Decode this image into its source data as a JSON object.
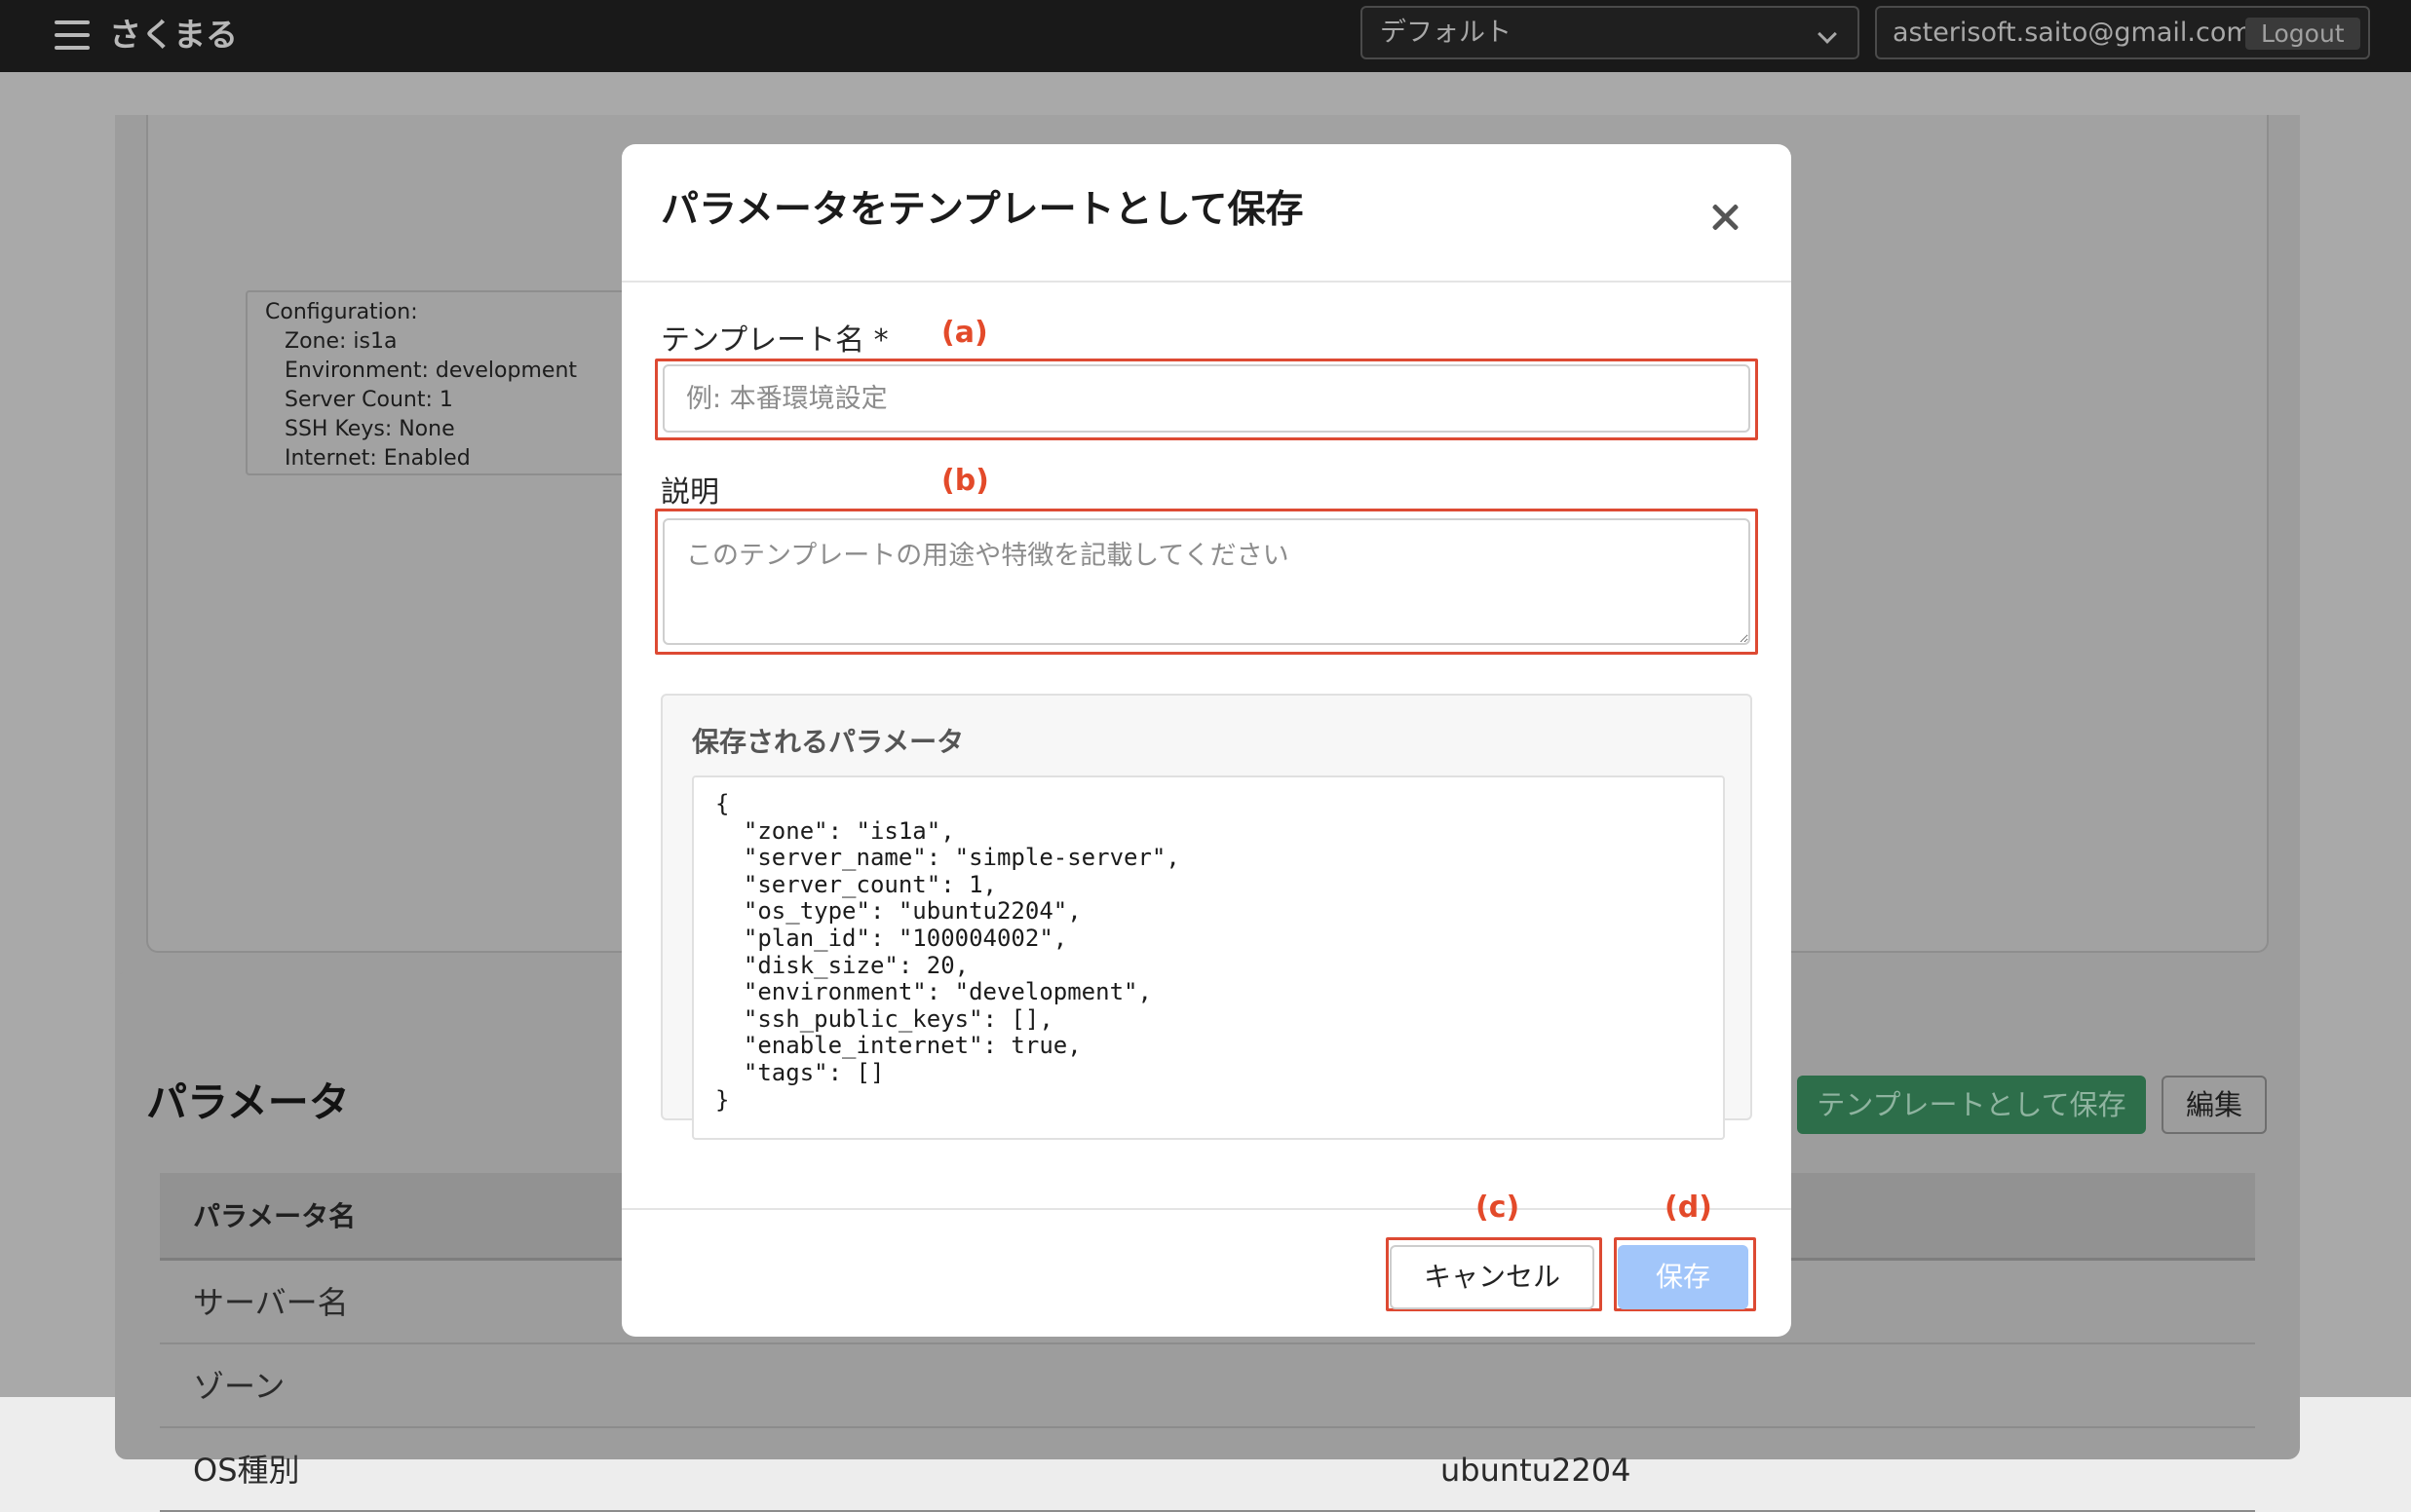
{
  "navbar": {
    "brand": "さくまる",
    "menu_icon": "hamburger-icon",
    "project_selected": "デフォルト",
    "user_email": "asterisoft.saito@gmail.com",
    "logout_label": "Logout"
  },
  "background": {
    "configuration": {
      "title": "Configuration:",
      "lines": [
        "Zone: is1a",
        "Environment: development",
        "Server Count: 1",
        "SSH Keys: None",
        "Internet: Enabled"
      ]
    },
    "parameters": {
      "title": "パラメータ",
      "save_template_label": "テンプレートとして保存",
      "edit_label": "編集",
      "table_header": "パラメータ名",
      "rows": [
        {
          "name": "サーバー名",
          "value": ""
        },
        {
          "name": "ゾーン",
          "value": ""
        },
        {
          "name": "OS種別",
          "value": "ubuntu2204"
        }
      ]
    }
  },
  "modal": {
    "title": "パラメータをテンプレートとして保存",
    "template_name_label": "テンプレート名 *",
    "template_name_placeholder": "例: 本番環境設定",
    "description_label": "説明",
    "description_placeholder": "このテンプレートの用途や特徴を記載してください",
    "params_title": "保存されるパラメータ",
    "params_json": "{\n  \"zone\": \"is1a\",\n  \"server_name\": \"simple-server\",\n  \"server_count\": 1,\n  \"os_type\": \"ubuntu2204\",\n  \"plan_id\": \"100004002\",\n  \"disk_size\": 20,\n  \"environment\": \"development\",\n  \"ssh_public_keys\": [],\n  \"enable_internet\": true,\n  \"tags\": []\n}",
    "cancel_label": "キャンセル",
    "save_label": "保存"
  },
  "annotations": {
    "a": "(a)",
    "b": "(b)",
    "c": "(c)",
    "d": "(d)",
    "color": "#e34a2a"
  },
  "colors": {
    "navbar_bg": "#191919",
    "save_button_disabled": "#a2c6fa",
    "template_button_bg": "#2d6e4a"
  }
}
